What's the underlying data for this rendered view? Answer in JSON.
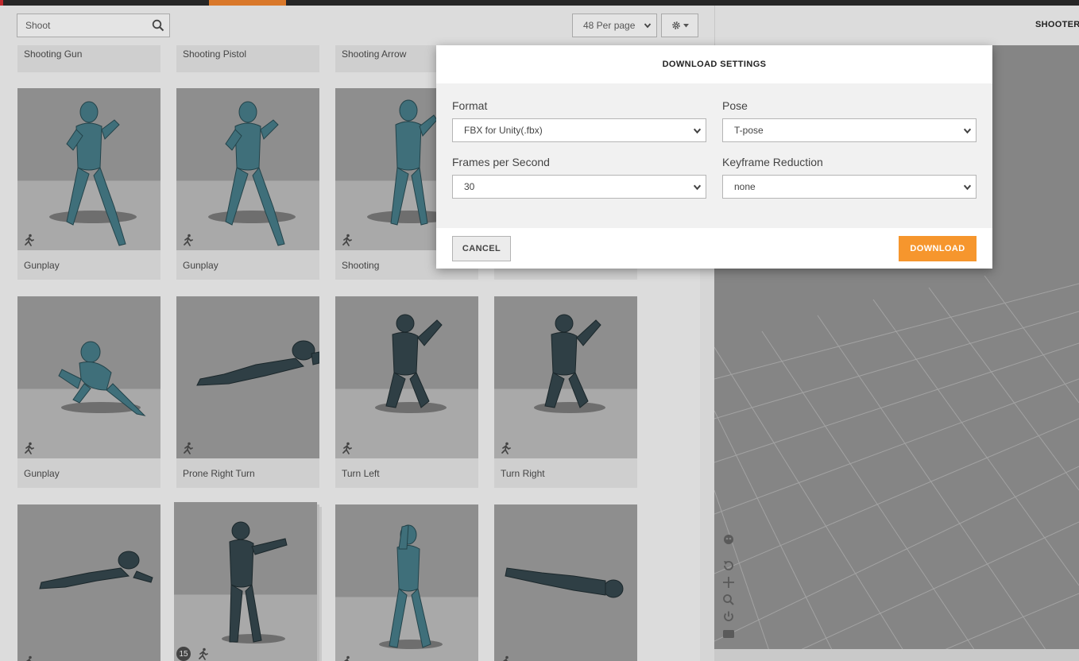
{
  "search": {
    "value": "Shoot"
  },
  "toolbar": {
    "per_page": "48 Per page"
  },
  "viewer": {
    "title": "SHOOTER"
  },
  "cards_row0": [
    {
      "label": "Shooting Gun"
    },
    {
      "label": "Shooting Pistol"
    },
    {
      "label": "Shooting Arrow"
    }
  ],
  "cards_row1": [
    {
      "label": "Gunplay"
    },
    {
      "label": "Gunplay"
    },
    {
      "label": "Shooting"
    }
  ],
  "cards_row2": [
    {
      "label": "Gunplay"
    },
    {
      "label": "Prone Right Turn"
    },
    {
      "label": "Turn Left"
    },
    {
      "label": "Turn Right"
    }
  ],
  "pack_badge": "15",
  "modal": {
    "title": "DOWNLOAD SETTINGS",
    "format_label": "Format",
    "format_value": "FBX for Unity(.fbx)",
    "pose_label": "Pose",
    "pose_value": "T-pose",
    "fps_label": "Frames per Second",
    "fps_value": "30",
    "keyframe_label": "Keyframe Reduction",
    "keyframe_value": "none",
    "cancel_label": "CANCEL",
    "download_label": "DOWNLOAD"
  },
  "colors": {
    "accent": "#f6962d",
    "topbar": "#262626",
    "brand_red": "#c0282c"
  }
}
